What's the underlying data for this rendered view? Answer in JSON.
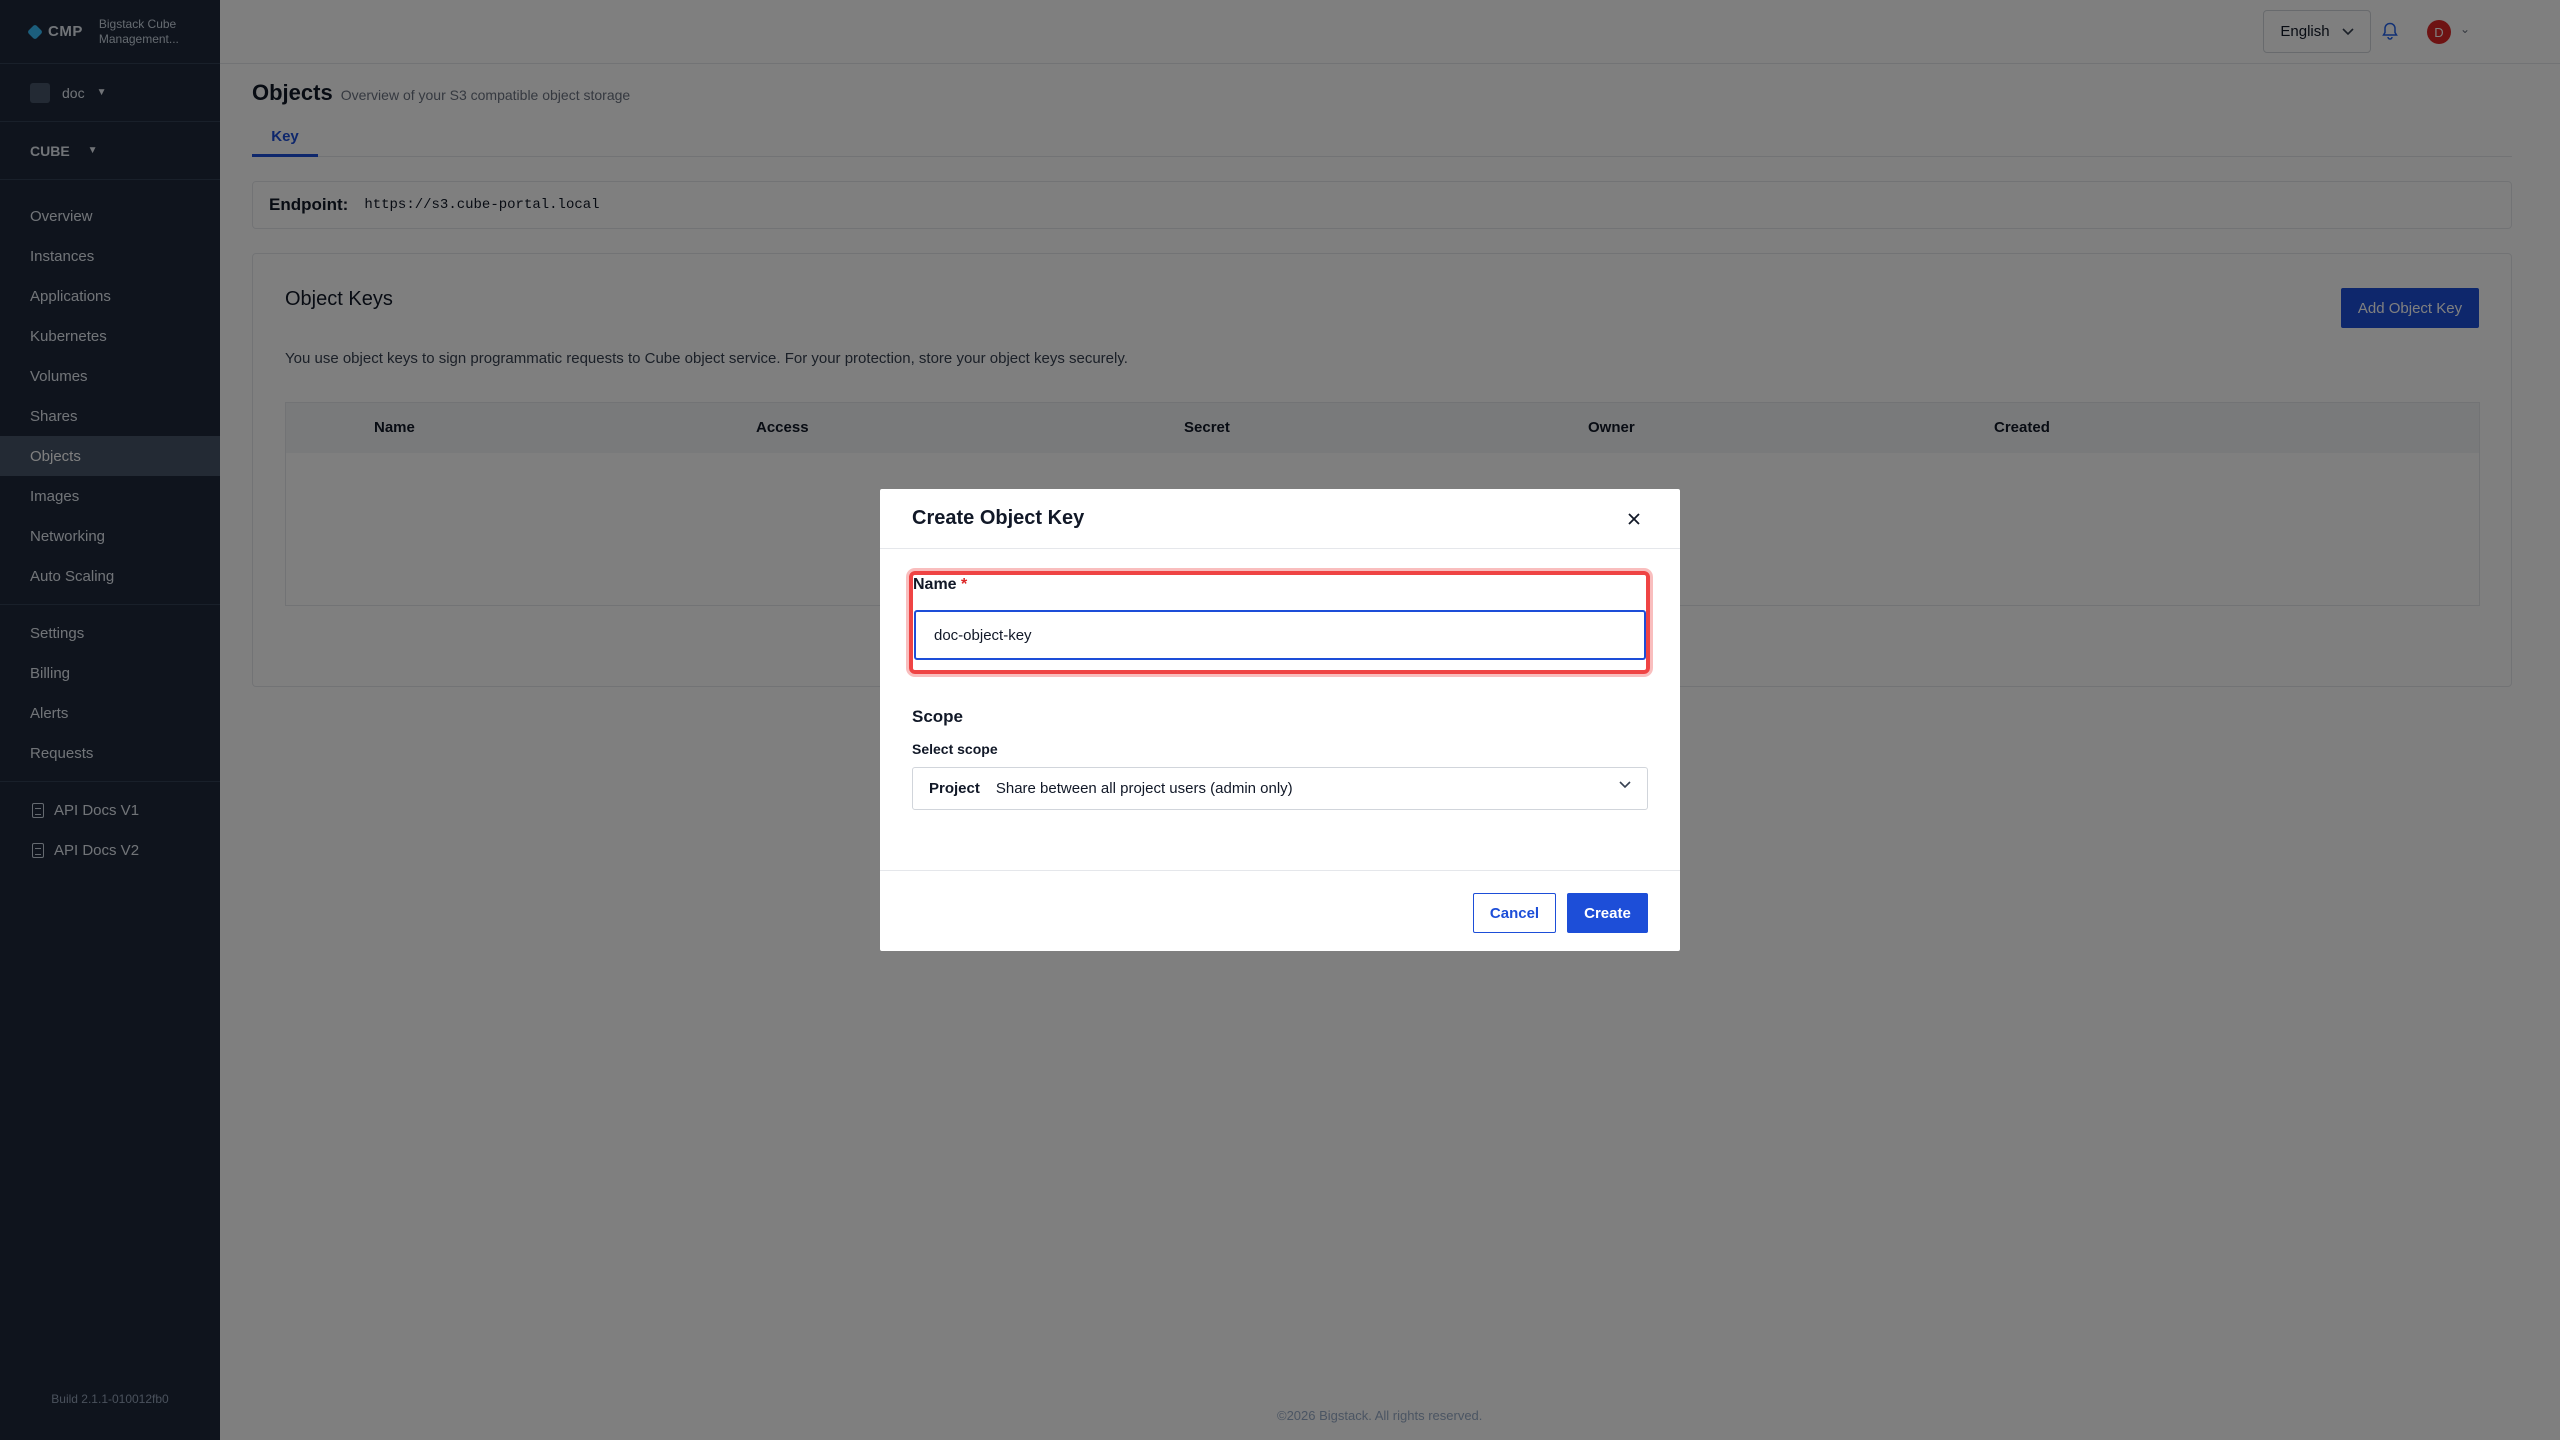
{
  "sidebar": {
    "logo": "CMP",
    "brand_name": "Bigstack Cube Management...",
    "project": "doc",
    "region": "CUBE",
    "nav_main": [
      "Overview",
      "Instances",
      "Applications",
      "Kubernetes",
      "Volumes",
      "Shares",
      "Objects",
      "Images",
      "Networking",
      "Auto Scaling"
    ],
    "nav_admin": [
      "Settings",
      "Billing",
      "Alerts",
      "Requests"
    ],
    "docs": [
      "API Docs V1",
      "API Docs V2"
    ],
    "build": "Build 2.1.1-010012fb0"
  },
  "topbar": {
    "language": "English",
    "avatar_initial": "D"
  },
  "page": {
    "title": "Objects",
    "subtitle": "Overview of your S3 compatible object storage",
    "tab": "Key",
    "endpoint_label": "Endpoint:",
    "endpoint_value": "https://s3.cube-portal.local",
    "card_title": "Object Keys",
    "add_button": "Add Object Key",
    "description": "You use object keys to sign programmatic requests to Cube object service. For your protection, store your object keys securely.",
    "table_headers": [
      "Name",
      "Access",
      "Secret",
      "Owner",
      "Created"
    ]
  },
  "modal": {
    "title": "Create Object Key",
    "name_label": "Name",
    "name_required": "*",
    "name_value": "doc-object-key",
    "scope_title": "Scope",
    "scope_label": "Select scope",
    "scope_key": "Project",
    "scope_value": "Share between all project users (admin only)",
    "cancel": "Cancel",
    "create": "Create"
  },
  "footer": "©2026 Bigstack. All rights reserved.",
  "colors": {
    "sidebar_bg": "#1e293b",
    "primary": "#1d4ed8",
    "highlight": "#ef4444"
  }
}
